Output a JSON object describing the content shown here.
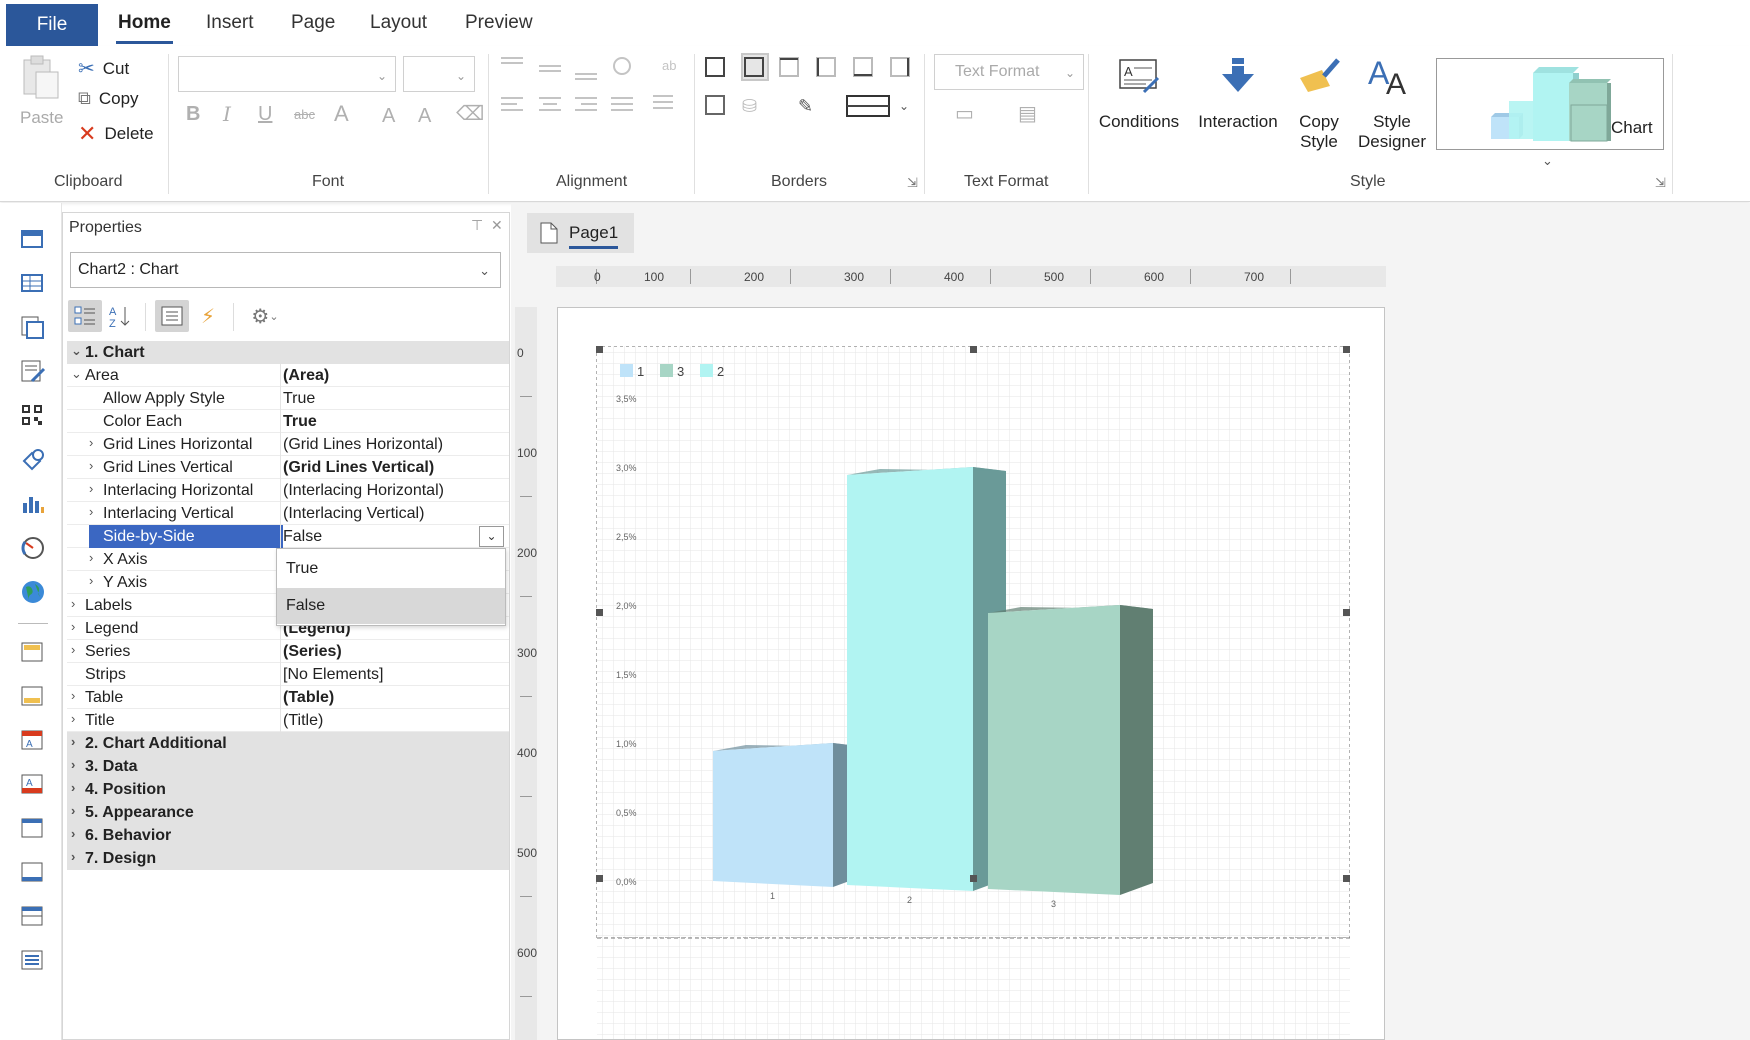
{
  "tabs": {
    "file": "File",
    "home": "Home",
    "insert": "Insert",
    "page": "Page",
    "layout": "Layout",
    "preview": "Preview"
  },
  "clipboard": {
    "paste": "Paste",
    "cut": "Cut",
    "copy": "Copy",
    "delete": "Delete",
    "label": "Clipboard"
  },
  "font": {
    "label": "Font"
  },
  "alignment": {
    "label": "Alignment"
  },
  "borders": {
    "label": "Borders"
  },
  "text_format": {
    "dropdown": "Text Format",
    "label": "Text Format"
  },
  "style": {
    "conditions": "Conditions",
    "interaction": "Interaction",
    "copy_style_1": "Copy",
    "copy_style_2": "Style",
    "style_designer_1": "Style",
    "style_designer_2": "Designer",
    "chart": "Chart",
    "label": "Style"
  },
  "properties": {
    "title": "Properties",
    "object": "Chart2 : Chart",
    "rows": [
      {
        "kind": "cat",
        "expander": "⌄",
        "name": "1. Chart"
      },
      {
        "kind": "prop",
        "expander": "⌄",
        "indent": 0,
        "name": "Area",
        "value": "(Area)",
        "bold": true
      },
      {
        "kind": "prop",
        "indent": 1,
        "name": "Allow Apply Style",
        "value": "True",
        "bold": false
      },
      {
        "kind": "prop",
        "indent": 1,
        "name": "Color Each",
        "value": "True",
        "bold": true
      },
      {
        "kind": "prop",
        "expander": "›",
        "indent": 1,
        "name": "Grid Lines Horizontal",
        "value": "(Grid Lines Horizontal)",
        "bold": false
      },
      {
        "kind": "prop",
        "expander": "›",
        "indent": 1,
        "name": "Grid Lines Vertical",
        "value": "(Grid Lines Vertical)",
        "bold": true
      },
      {
        "kind": "prop",
        "expander": "›",
        "indent": 1,
        "name": "Interlacing Horizontal",
        "value": "(Interlacing Horizontal)",
        "bold": false
      },
      {
        "kind": "prop",
        "expander": "›",
        "indent": 1,
        "name": "Interlacing Vertical",
        "value": "(Interlacing Vertical)",
        "bold": false
      },
      {
        "kind": "prop",
        "indent": 1,
        "name": "Side-by-Side",
        "value": "False",
        "bold": false,
        "selected": true
      },
      {
        "kind": "prop",
        "expander": "›",
        "indent": 1,
        "name": "X Axis",
        "value": "",
        "bold": false
      },
      {
        "kind": "prop",
        "expander": "›",
        "indent": 1,
        "name": "Y Axis",
        "value": "",
        "bold": false
      },
      {
        "kind": "prop",
        "expander": "›",
        "indent": 0,
        "name": "Labels",
        "value": "",
        "bold": false
      },
      {
        "kind": "prop",
        "expander": "›",
        "indent": 0,
        "name": "Legend",
        "value": "(Legend)",
        "bold": true
      },
      {
        "kind": "prop",
        "expander": "›",
        "indent": 0,
        "name": "Series",
        "value": "(Series)",
        "bold": true
      },
      {
        "kind": "prop",
        "indent": 0,
        "name": "Strips",
        "value": "[No Elements]",
        "bold": false
      },
      {
        "kind": "prop",
        "expander": "›",
        "indent": 0,
        "name": "Table",
        "value": "(Table)",
        "bold": true
      },
      {
        "kind": "prop",
        "expander": "›",
        "indent": 0,
        "name": "Title",
        "value": "(Title)",
        "bold": false
      },
      {
        "kind": "cat",
        "expander": "›",
        "name": "2. Chart  Additional"
      },
      {
        "kind": "cat",
        "expander": "›",
        "name": "3. Data"
      },
      {
        "kind": "cat",
        "expander": "›",
        "name": "4. Position"
      },
      {
        "kind": "cat",
        "expander": "›",
        "name": "5. Appearance"
      },
      {
        "kind": "cat",
        "expander": "›",
        "name": "6. Behavior"
      },
      {
        "kind": "cat",
        "expander": "›",
        "name": "7. Design"
      }
    ],
    "dropdown_options": [
      "True",
      "False"
    ],
    "dropdown_selected": "False"
  },
  "designer": {
    "page_tab": "Page1",
    "hruler": [
      "0",
      "100",
      "200",
      "300",
      "400",
      "500",
      "600",
      "700"
    ],
    "vruler": [
      "0",
      "100",
      "200",
      "300",
      "400",
      "500",
      "600"
    ]
  },
  "chart_data": {
    "type": "bar",
    "categories": [
      "1",
      "2",
      "3"
    ],
    "values": [
      1.0,
      3.0,
      2.0
    ],
    "legend": [
      "1",
      "3",
      "2"
    ],
    "colors": [
      "#bfe3f9",
      "#b1f4f2",
      "#a7d5c5"
    ],
    "side_colors": [
      "#6f8e9c",
      "#6a9a98",
      "#617f72"
    ],
    "y_ticks": [
      "0,0%",
      "0,5%",
      "1,0%",
      "1,5%",
      "2,0%",
      "2,5%",
      "3,0%",
      "3,5%"
    ],
    "ylim": [
      0,
      3.5
    ],
    "legend_position": "top-left",
    "grid": true
  }
}
